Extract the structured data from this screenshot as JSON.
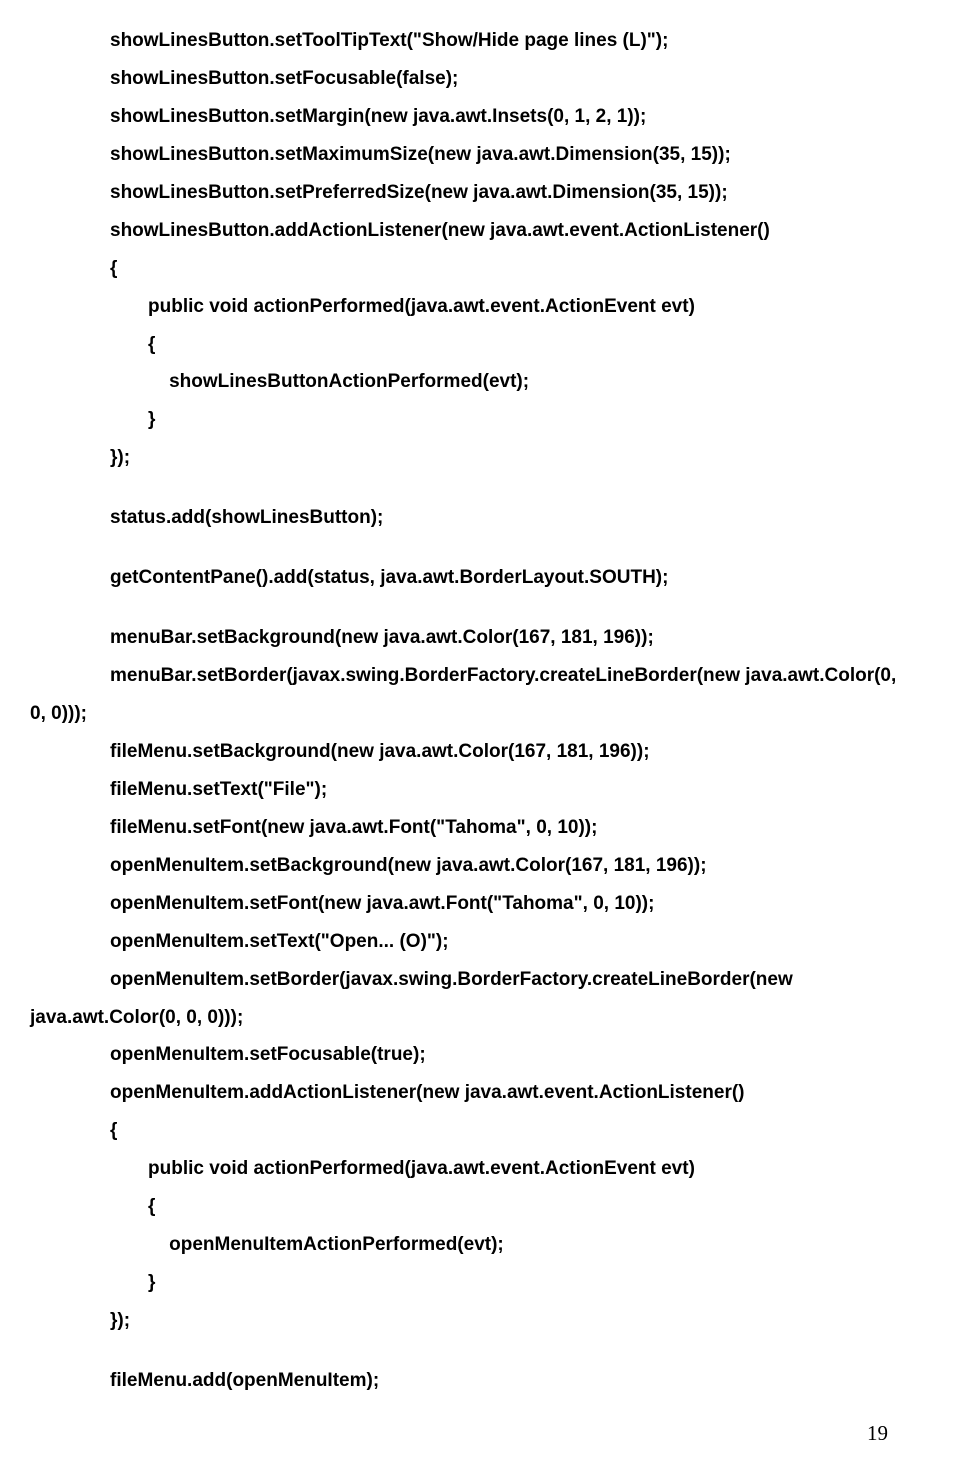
{
  "lines": [
    {
      "cls": "indent1",
      "text": "showLinesButton.setToolTipText(\"Show/Hide page lines (L)\");"
    },
    {
      "cls": "indent1",
      "text": "showLinesButton.setFocusable(false);"
    },
    {
      "cls": "indent1",
      "text": "showLinesButton.setMargin(new java.awt.Insets(0, 1, 2, 1));"
    },
    {
      "cls": "indent1",
      "text": "showLinesButton.setMaximumSize(new java.awt.Dimension(35, 15));"
    },
    {
      "cls": "indent1",
      "text": "showLinesButton.setPreferredSize(new java.awt.Dimension(35, 15));"
    },
    {
      "cls": "indent1",
      "text": "showLinesButton.addActionListener(new java.awt.event.ActionListener()"
    },
    {
      "cls": "indent1",
      "text": "{"
    },
    {
      "cls": "indent2",
      "text": "public void actionPerformed(java.awt.event.ActionEvent evt)"
    },
    {
      "cls": "indent2",
      "text": "{"
    },
    {
      "cls": "indent2",
      "text": "    showLinesButtonActionPerformed(evt);"
    },
    {
      "cls": "indent2",
      "text": "}"
    },
    {
      "cls": "indent1",
      "text": "});"
    },
    {
      "cls": "gap",
      "text": ""
    },
    {
      "cls": "indent1",
      "text": "status.add(showLinesButton);"
    },
    {
      "cls": "gap",
      "text": ""
    },
    {
      "cls": "indent1",
      "text": "getContentPane().add(status, java.awt.BorderLayout.SOUTH);"
    },
    {
      "cls": "gap",
      "text": ""
    },
    {
      "cls": "indent1",
      "text": "menuBar.setBackground(new java.awt.Color(167, 181, 196));"
    },
    {
      "cls": "indent1",
      "text": "menuBar.setBorder(javax.swing.BorderFactory.createLineBorder(new java.awt.Color(0,"
    },
    {
      "cls": "start",
      "text": "0, 0)));"
    },
    {
      "cls": "indent1",
      "text": "fileMenu.setBackground(new java.awt.Color(167, 181, 196));"
    },
    {
      "cls": "indent1",
      "text": "fileMenu.setText(\"File\");"
    },
    {
      "cls": "indent1",
      "text": "fileMenu.setFont(new java.awt.Font(\"Tahoma\", 0, 10));"
    },
    {
      "cls": "indent1",
      "text": "openMenuItem.setBackground(new java.awt.Color(167, 181, 196));"
    },
    {
      "cls": "indent1",
      "text": "openMenuItem.setFont(new java.awt.Font(\"Tahoma\", 0, 10));"
    },
    {
      "cls": "indent1",
      "text": "openMenuItem.setText(\"Open... (O)\");"
    },
    {
      "cls": "indent1",
      "text": "openMenuItem.setBorder(javax.swing.BorderFactory.createLineBorder(new"
    },
    {
      "cls": "start",
      "text": "java.awt.Color(0, 0, 0)));"
    },
    {
      "cls": "indent1",
      "text": "openMenuItem.setFocusable(true);"
    },
    {
      "cls": "indent1",
      "text": "openMenuItem.addActionListener(new java.awt.event.ActionListener()"
    },
    {
      "cls": "indent1",
      "text": "{"
    },
    {
      "cls": "indent2",
      "text": "public void actionPerformed(java.awt.event.ActionEvent evt)"
    },
    {
      "cls": "indent2",
      "text": "{"
    },
    {
      "cls": "indent2",
      "text": "    openMenuItemActionPerformed(evt);"
    },
    {
      "cls": "indent2",
      "text": "}"
    },
    {
      "cls": "indent1",
      "text": "});"
    },
    {
      "cls": "gap",
      "text": ""
    },
    {
      "cls": "indent1",
      "text": "fileMenu.add(openMenuItem);"
    }
  ],
  "page_number": "19"
}
